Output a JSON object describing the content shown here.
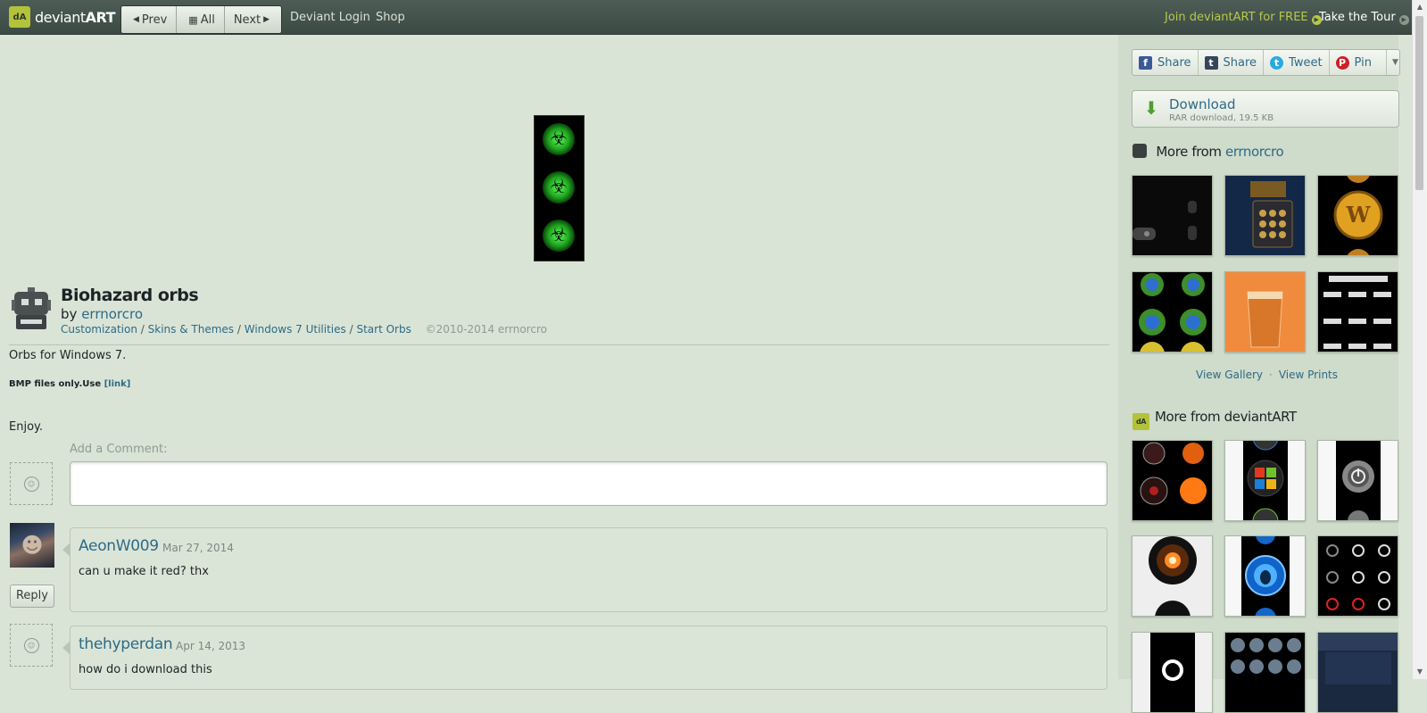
{
  "topbar": {
    "logo_mark": "dA",
    "logo_text_light": "deviant",
    "logo_text_bold": "ART",
    "prev": "Prev",
    "all": "All",
    "next": "Next",
    "deviant_login": "Deviant Login",
    "shop": "Shop",
    "join": "Join deviantART for FREE",
    "tour": "Take the Tour"
  },
  "deviation": {
    "title": "Biohazard orbs",
    "by": "by",
    "author": "errnorcro",
    "categories": [
      "Customization",
      "Skins & Themes",
      "Windows 7 Utilities",
      "Start Orbs"
    ],
    "category_sep": "/",
    "copyright": "©2010-2014 errnorcro",
    "description_1": "Orbs for Windows 7.",
    "description_2": "BMP files only.Use",
    "description_link": "[link]",
    "description_3": "Enjoy."
  },
  "comments": {
    "add_label": "Add a Comment:",
    "reply_label": "Reply",
    "items": [
      {
        "user": "AeonW009",
        "date": "Mar 27, 2014",
        "text": "can u make it red? thx"
      },
      {
        "user": "thehyperdan",
        "date": "Apr 14, 2013",
        "text": "how do i download this"
      }
    ]
  },
  "sidebar": {
    "share": [
      {
        "label": "Share",
        "icon": "facebook-icon",
        "glyph": "f",
        "color": "#3b5998"
      },
      {
        "label": "Share",
        "icon": "tumblr-icon",
        "glyph": "t",
        "color": "#35465c"
      },
      {
        "label": "Tweet",
        "icon": "twitter-icon",
        "glyph": "t",
        "color": "#2aa9e0"
      },
      {
        "label": "Pin",
        "icon": "pinterest-icon",
        "glyph": "P",
        "color": "#cb2027"
      }
    ],
    "download_title": "Download",
    "download_sub": "RAR download, 19.5 KB",
    "more_from_prefix": "More from",
    "more_from_user": "errnorcro",
    "view_gallery": "View Gallery",
    "view_prints": "View Prints",
    "more_from_da": "More from deviantART"
  },
  "colors": {
    "background": "#dae4d6",
    "topbar": "#44534c",
    "link": "#2d6a86",
    "join": "#b7c84a",
    "orb_green": "#2ad42a"
  }
}
